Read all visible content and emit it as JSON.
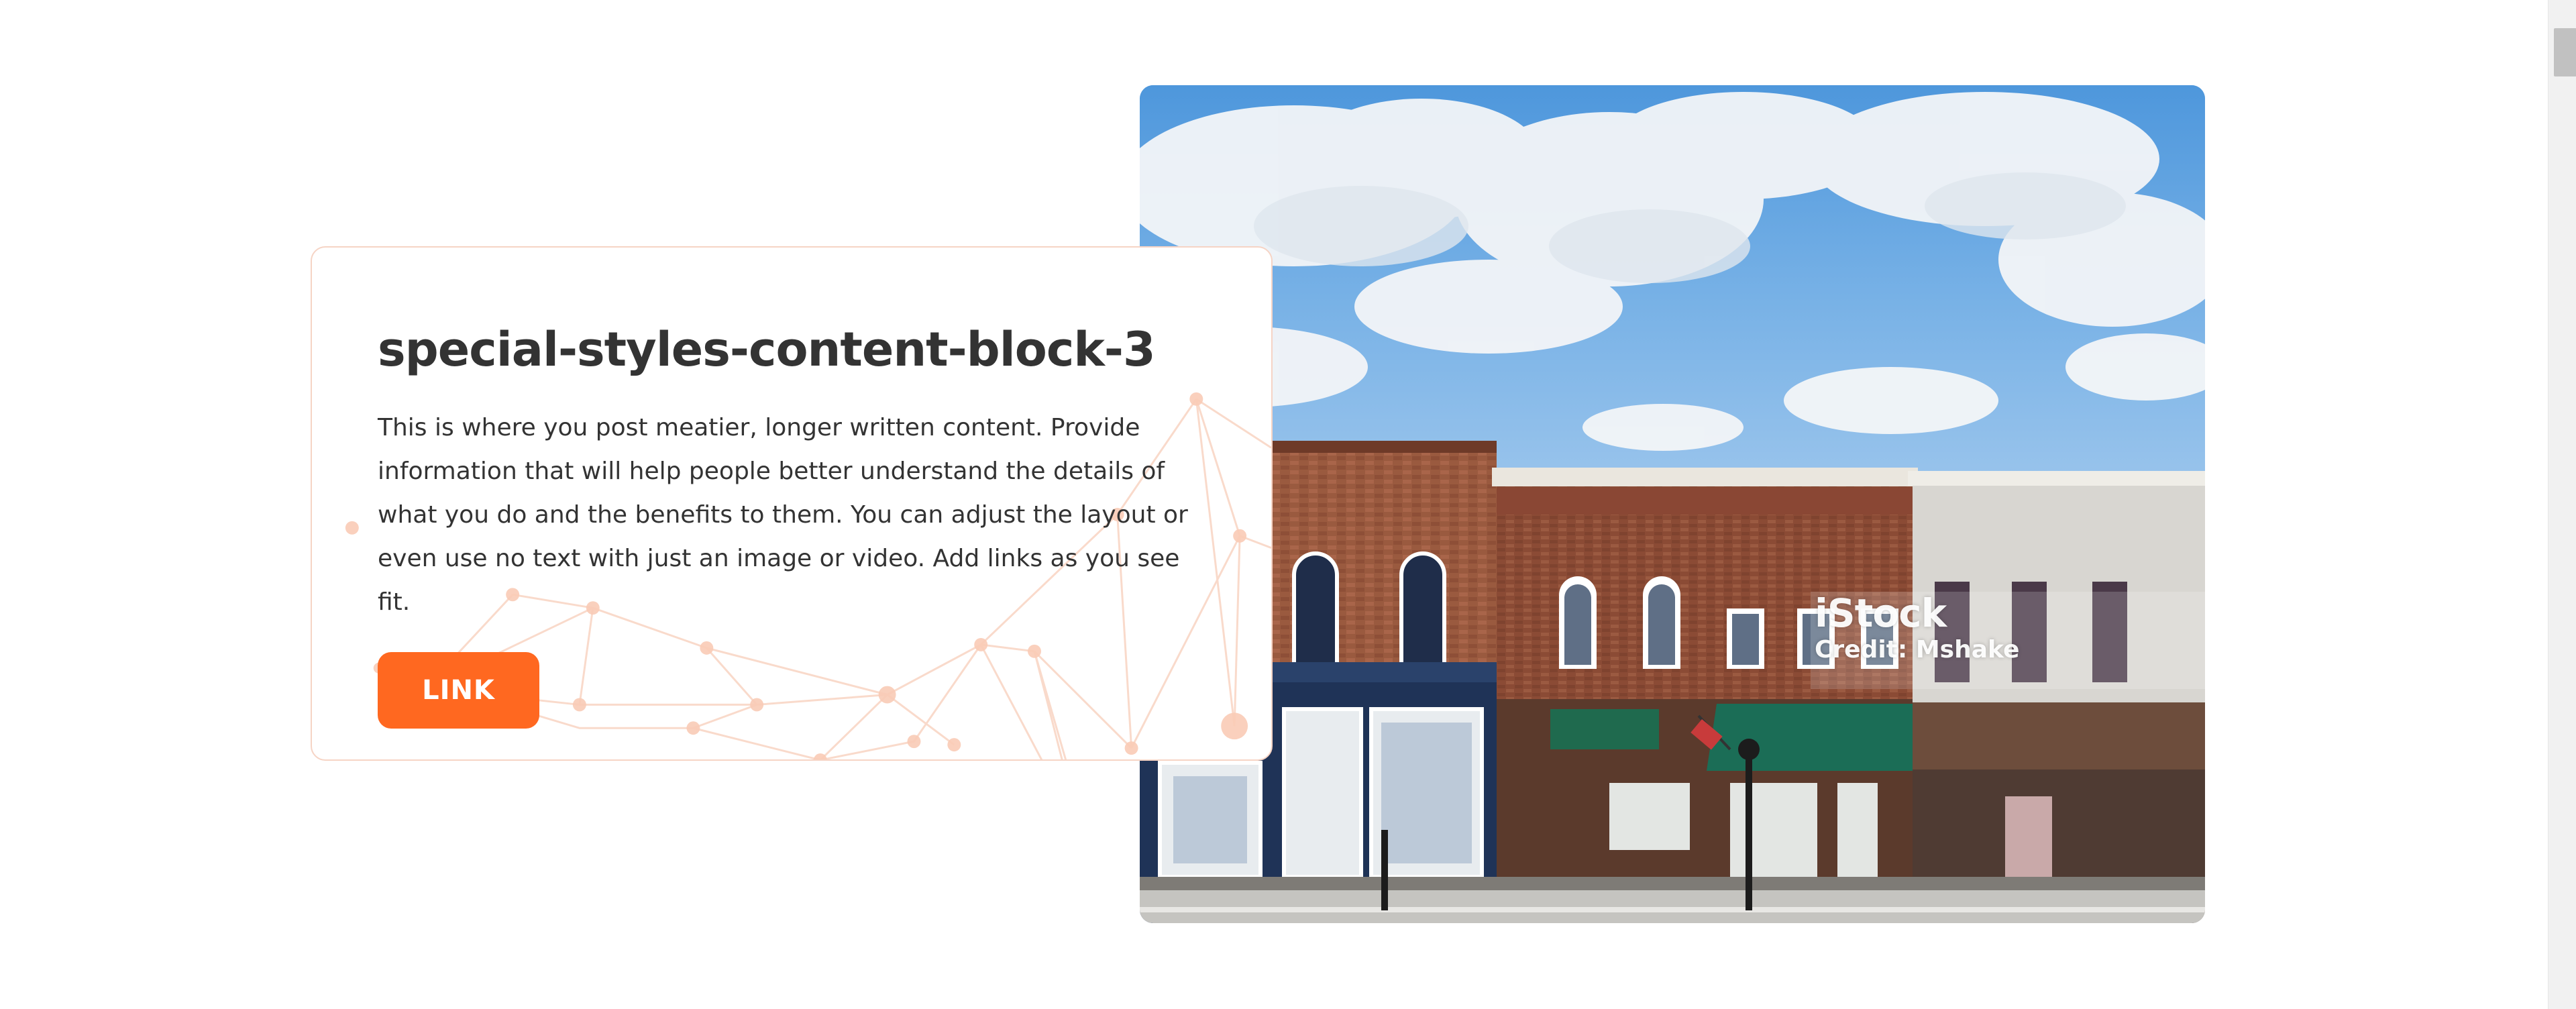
{
  "content_block": {
    "title": "special-styles-content-block-3",
    "body": "This is where you post meatier, longer written content. Provide information that will help people better understand the details of what you do and the benefits to them. You can adjust the layout or even use no text with just an image or video. Add links as you see fit.",
    "button_label": "LINK"
  },
  "image": {
    "subject": "small-town main street storefronts under a cloudy blue sky",
    "watermark_brand": "iStock",
    "watermark_credit": "Credit: Mshake"
  },
  "colors": {
    "accent": "#ff6820",
    "card_border": "#f6d4c5",
    "text": "#333333",
    "background": "#ffffff"
  }
}
